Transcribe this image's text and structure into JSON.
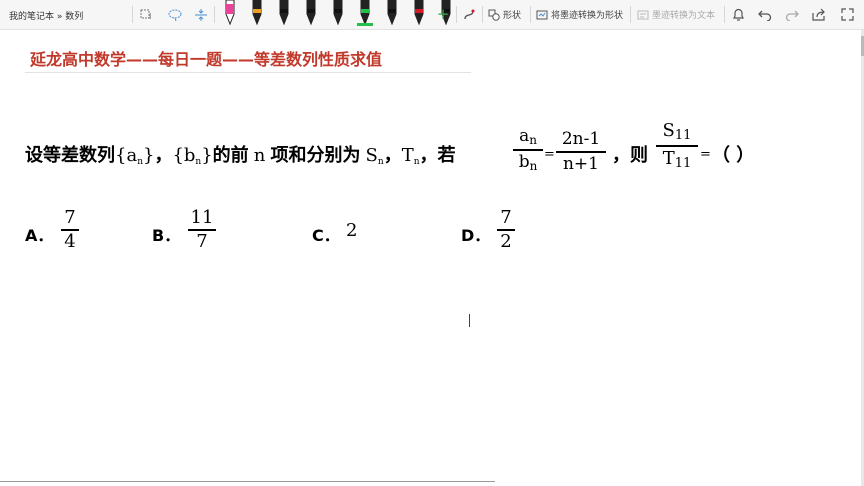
{
  "toolbar": {
    "breadcrumb": "我的笔记本 » 数列",
    "shape_label": "形状",
    "ink_to_shape_label": "将墨迹转换为形状",
    "ink_to_text_label": "墨迹转换为文本",
    "pen_colors": [
      "#e8449a",
      "#f0a020",
      "#111111",
      "#111111",
      "#111111",
      "#22c04a",
      "#111111",
      "#d6192a",
      "#111111"
    ]
  },
  "page": {
    "title": "延龙高中数学——每日一题——等差数列性质求值"
  },
  "question": {
    "seg1": "设等差数列",
    "a_seq_open": "{a",
    "sub_n1": "n",
    "a_seq_close": "}",
    "sep1": "，",
    "b_seq_open": "{b",
    "sub_n2": "n",
    "b_seq_close": "}",
    "seg2": "的前",
    "n": "n",
    "seg3": "项和分别为",
    "S": "S",
    "sub_n3": "n",
    "sep2": "，",
    "T": "T",
    "sub_n4": "n",
    "seg4": "，若",
    "ratio_num": "an",
    "ratio_den": "bn",
    "eq1": "=",
    "rhs_num": "2n-1",
    "rhs_den": "n+1",
    "seg5": "，则",
    "st_num": "S11",
    "st_den": "T11",
    "eq2": "=",
    "blank": "（        ）"
  },
  "options": [
    {
      "label": "A．",
      "num": "7",
      "den": "4"
    },
    {
      "label": "B．",
      "num": "11",
      "den": "7"
    },
    {
      "label": "C．",
      "value": "2"
    },
    {
      "label": "D．",
      "num": "7",
      "den": "2"
    }
  ]
}
